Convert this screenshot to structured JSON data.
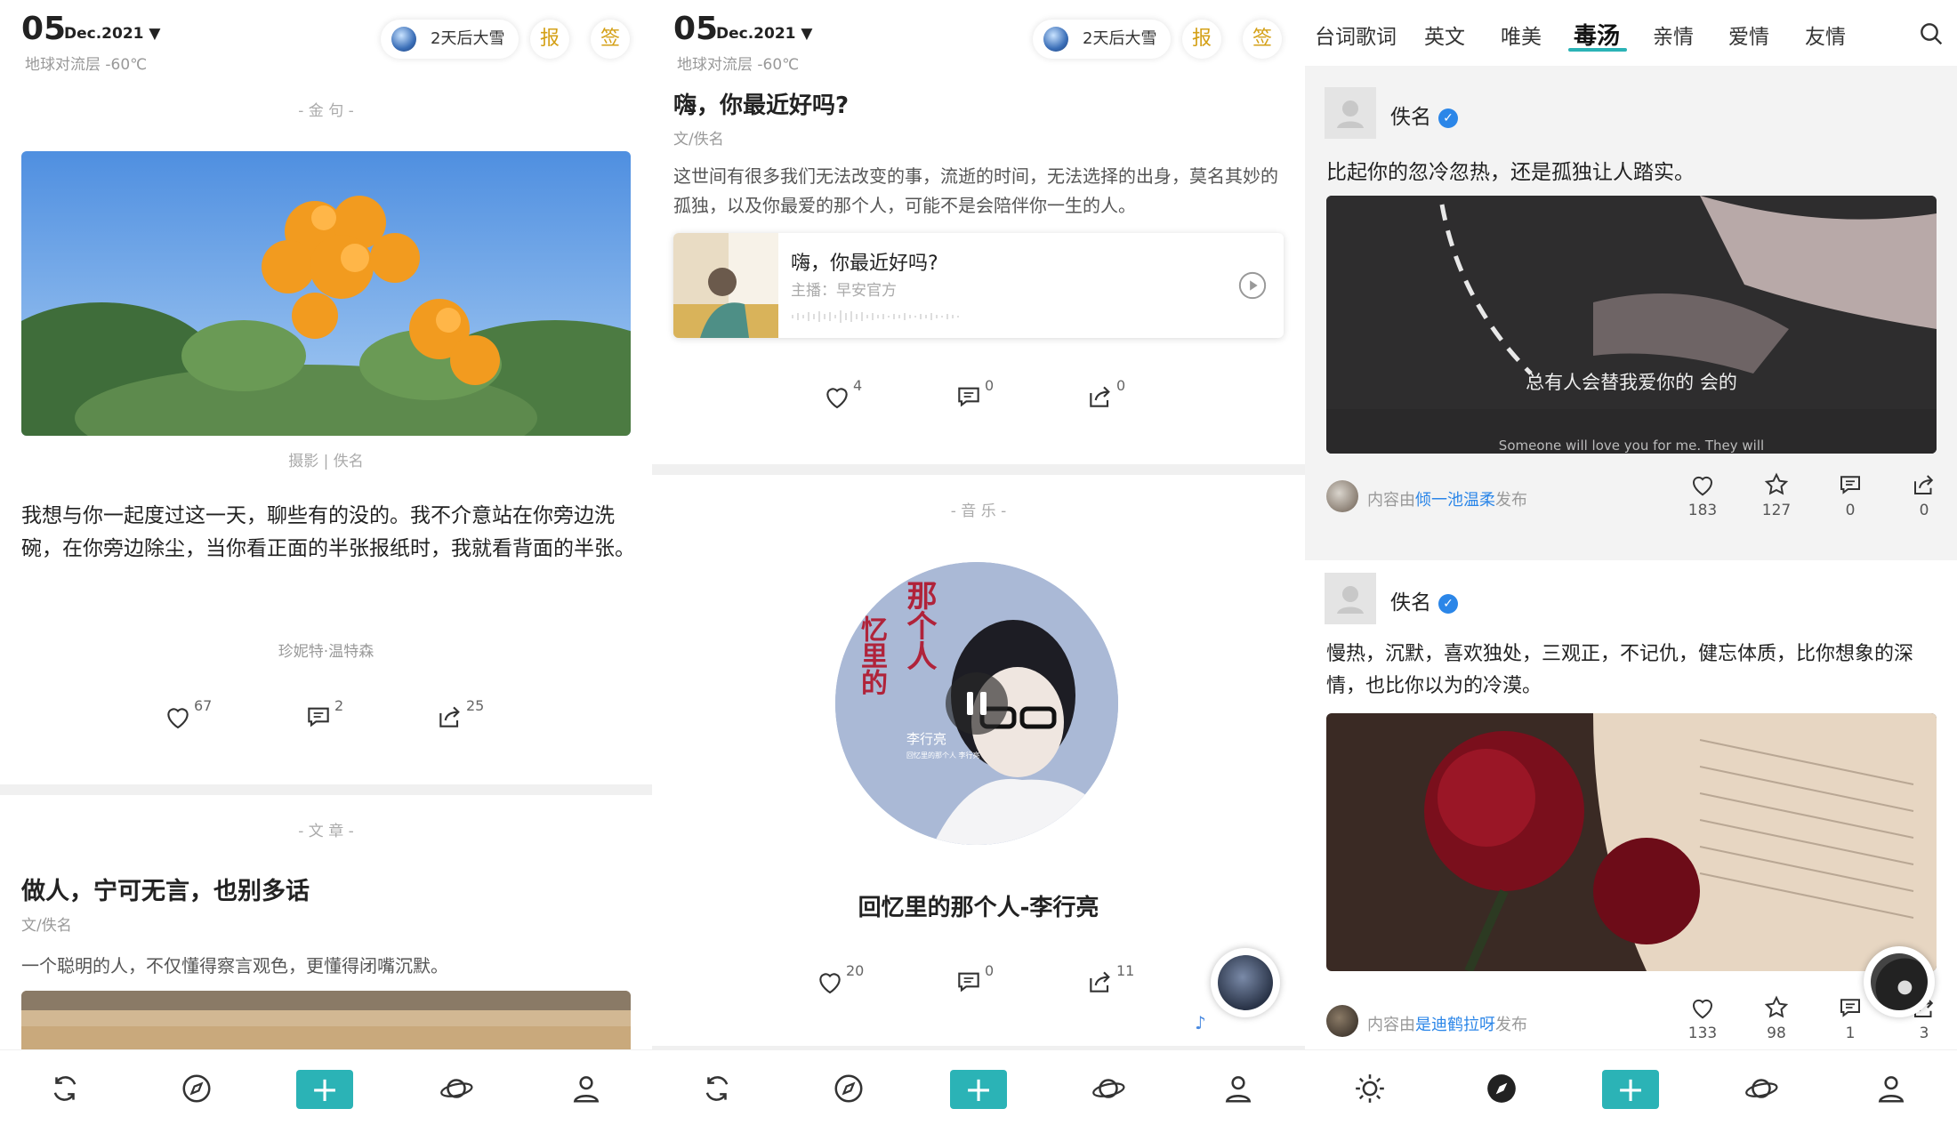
{
  "panel1": {
    "date_day": "05",
    "date_month": "Dec.2021 ▼",
    "location": "地球对流层 -60℃",
    "weather": "2天后大雪",
    "btn_report": "报",
    "btn_sign": "签",
    "section_quote": "- 金 句 -",
    "photo_caption": "摄影 | 佚名",
    "quote_text": "我想与你一起度过这一天，聊些有的没的。我不介意站在你旁边洗碗，在你旁边除尘，当你看正面的半张报纸时，我就看背面的半张。",
    "quote_author": "珍妮特·温特森",
    "likes": "67",
    "comments": "2",
    "shares": "25",
    "section_article": "- 文 章 -",
    "article_title": "做人，宁可无言，也别多话",
    "article_author": "文/佚名",
    "article_excerpt": "一个聪明的人，不仅懂得察言观色，更懂得闭嘴沉默。"
  },
  "panel2": {
    "date_day": "05",
    "date_month": "Dec.2021 ▼",
    "location": "地球对流层 -60℃",
    "weather": "2天后大雪",
    "btn_report": "报",
    "btn_sign": "签",
    "radio_title": "嗨，你最近好吗?",
    "radio_author": "文/佚名",
    "radio_text": "这世间有很多我们无法改变的事，流逝的时间，无法选择的出身，莫名其妙的孤独，以及你最爱的那个人，可能不是会陪伴你一生的人。",
    "audio_title": "嗨，你最近好吗?",
    "audio_host": "主播：早安官方",
    "likes": "4",
    "comments": "0",
    "shares": "0",
    "section_music": "- 音 乐 -",
    "album_text_a": "那个人",
    "album_text_b": "忆里的",
    "album_artist": "李行亮",
    "album_small": "回忆里的那个人 李行亮",
    "song_title": "回忆里的那个人-李行亮",
    "music_likes": "20",
    "music_comments": "0",
    "music_shares": "11"
  },
  "panel3": {
    "tabs": [
      "台词歌词",
      "英文",
      "唯美",
      "毒汤",
      "亲情",
      "爱情",
      "友情"
    ],
    "active_tab": 3,
    "posts": [
      {
        "author": "佚名",
        "text": "比起你的忽冷忽热，还是孤独让人踏实。",
        "image_caption": "总有人会替我爱你的 会的",
        "image_caption_en": "Someone will love you for me. They will",
        "publisher_prefix": "内容由",
        "publisher": "倾一池温柔",
        "publisher_suffix": "发布",
        "likes": "183",
        "stars": "127",
        "comments": "0",
        "shares": "0"
      },
      {
        "author": "佚名",
        "text": "慢热，沉默，喜欢独处，三观正，不记仇，健忘体质，比你想象的深情，也比你以为的冷漠。",
        "publisher_prefix": "内容由",
        "publisher": "是迪鹤拉呀",
        "publisher_suffix": "发布",
        "likes": "133",
        "stars": "98",
        "comments": "1",
        "shares": "3"
      }
    ]
  },
  "colors": {
    "accent": "#2bb3b6",
    "gold": "#d4a017",
    "link": "#2b86e8",
    "muted": "#999999"
  }
}
